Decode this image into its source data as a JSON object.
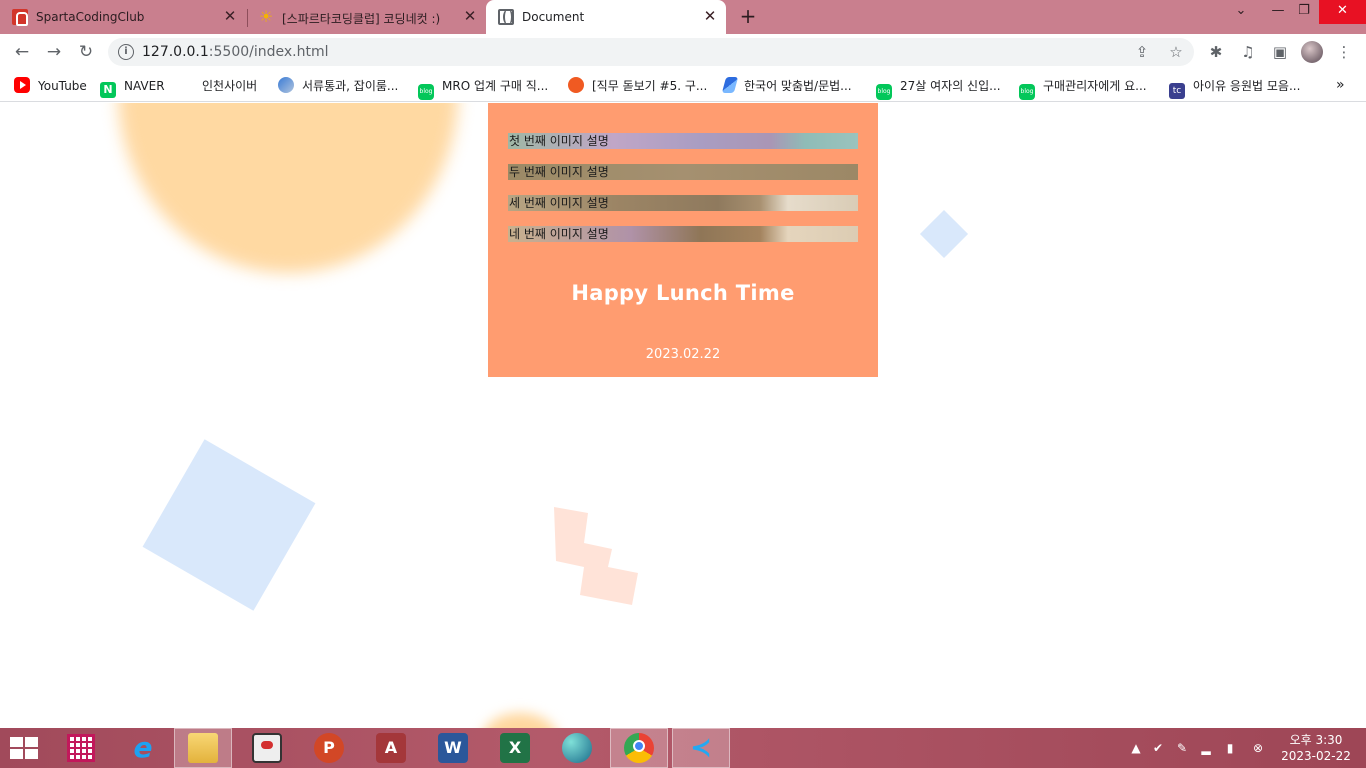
{
  "browser": {
    "tabs": [
      {
        "title": "SpartaCodingClub",
        "icon": "sparta-icon",
        "active": false
      },
      {
        "title": "[스파르타코딩클럽] 코딩네컷 :)",
        "icon": "sun-icon",
        "active": false
      },
      {
        "title": "Document",
        "icon": "globe-icon",
        "active": true
      }
    ],
    "address": {
      "host": "127.0.0.1",
      "path": ":5500/index.html"
    },
    "bookmarks": [
      {
        "label": "YouTube",
        "icon": "youtube-icon"
      },
      {
        "label": "NAVER",
        "icon": "naver-icon"
      },
      {
        "label": "인천사이버",
        "icon": ""
      },
      {
        "label": "서류통과, 잡이룸...",
        "icon": "globe-icon"
      },
      {
        "label": "MRO 업계 구매 직...",
        "icon": "blog-icon"
      },
      {
        "label": "[직무 돋보기 #5. 구...",
        "icon": "orange-circle-icon"
      },
      {
        "label": "한국어 맞춤법/문법...",
        "icon": "spellcheck-icon"
      },
      {
        "label": "27살 여자의 신입...",
        "icon": "blog-icon"
      },
      {
        "label": "구매관리자에게 요...",
        "icon": "blog-icon"
      },
      {
        "label": "아이유 응원법 모음...",
        "icon": "tc-icon"
      }
    ]
  },
  "page": {
    "slides": [
      {
        "caption": "첫 번째 이미지 설명"
      },
      {
        "caption": "두 번째 이미지 설명"
      },
      {
        "caption": "세 번째 이미지 설명"
      },
      {
        "caption": "네 번째 이미지 설명"
      }
    ],
    "title": "Happy Lunch Time",
    "date": "2023.02.22",
    "colors": {
      "card": "#ff9c70",
      "decor_blue": "#d9e8fb",
      "decor_orange": "#ffd79e",
      "decor_peach": "#ffe3d8"
    }
  },
  "taskbar": {
    "apps": [
      "windows-start-icon",
      "apps-grid-icon",
      "internet-explorer-icon",
      "file-explorer-icon",
      "toggle-app-icon",
      "powerpoint-icon",
      "access-icon",
      "word-icon",
      "excel-icon",
      "swirl-app-icon",
      "chrome-icon",
      "vscode-icon"
    ],
    "powerpoint_letter": "P",
    "access_letter": "A",
    "word_letter": "W",
    "excel_letter": "X",
    "clock_time": "오후 3:30",
    "clock_date": "2023-02-22"
  }
}
